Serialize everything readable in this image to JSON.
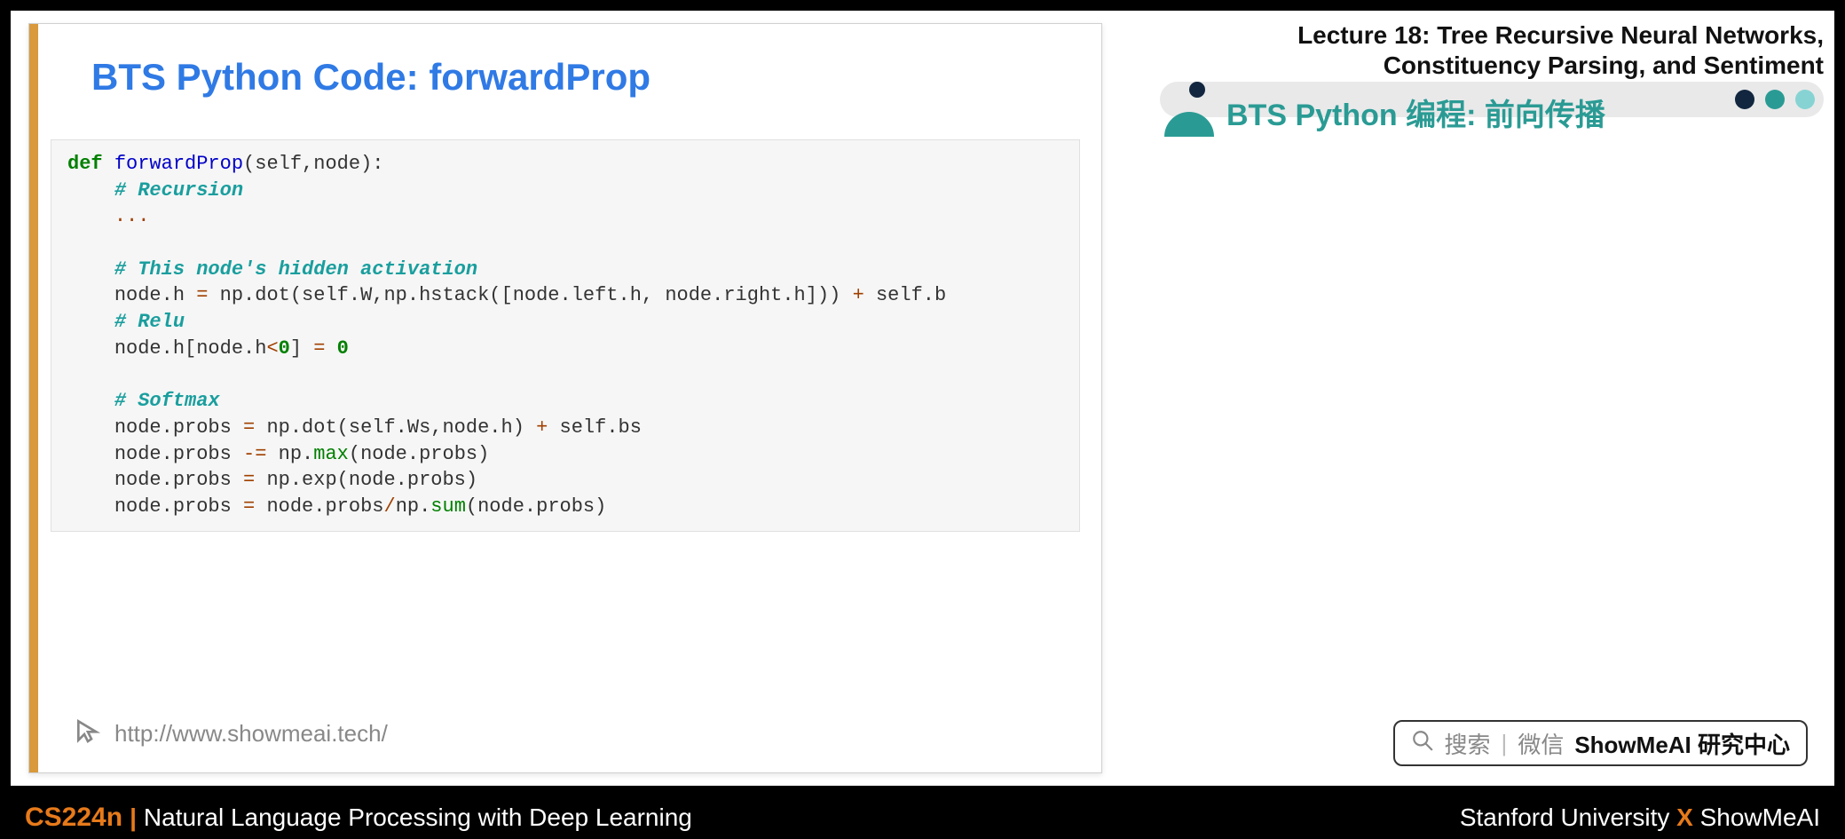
{
  "slide": {
    "title": "BTS Python Code: forwardProp",
    "footer_url": "http://www.showmeai.tech/"
  },
  "code": {
    "def": "def",
    "fn_name": "forwardProp",
    "params": "(self,node):",
    "c_recursion": "# Recursion",
    "ellipsis": "...",
    "c_hidden": "# This node's hidden activation",
    "l_hidden_a": "node.h ",
    "l_hidden_eq": "=",
    "l_hidden_b": " np.dot(self.W,np.hstack([node.left.h, node.right.h])) ",
    "l_hidden_plus": "+",
    "l_hidden_c": " self.b",
    "c_relu": "# Relu",
    "l_relu_a": "node.h[node.h",
    "l_relu_lt": "<",
    "l_relu_zero1": "0",
    "l_relu_b": "] ",
    "l_relu_eq": "=",
    "l_relu_sp": " ",
    "l_relu_zero2": "0",
    "c_softmax": "# Softmax",
    "l_s1_a": "node.probs ",
    "l_s1_eq": "=",
    "l_s1_b": " np.dot(self.Ws,node.h) ",
    "l_s1_plus": "+",
    "l_s1_c": " self.bs",
    "l_s2_a": "node.probs ",
    "l_s2_minuseq": "-=",
    "l_s2_b": " np.",
    "l_s2_max": "max",
    "l_s2_c": "(node.probs)",
    "l_s3_a": "node.probs ",
    "l_s3_eq": "=",
    "l_s3_b": " np.exp(node.probs)",
    "l_s4_a": "node.probs ",
    "l_s4_eq": "=",
    "l_s4_b": " node.probs",
    "l_s4_slash": "/",
    "l_s4_c": "np.",
    "l_s4_sum": "sum",
    "l_s4_d": "(node.probs)"
  },
  "right": {
    "line1": "Lecture 18: Tree Recursive Neural Networks,",
    "line2": "Constituency Parsing, and Sentiment",
    "side_title": "BTS Python 编程: 前向传播"
  },
  "search": {
    "label": "搜索",
    "divider": "|",
    "wechat": "微信",
    "brand": "ShowMeAI 研究中心"
  },
  "bottom": {
    "code": "CS224n",
    "pipe": "|",
    "name": "Natural Language Processing with Deep Learning",
    "univ": "Stanford University ",
    "x": "X",
    "org": " ShowMeAI"
  }
}
